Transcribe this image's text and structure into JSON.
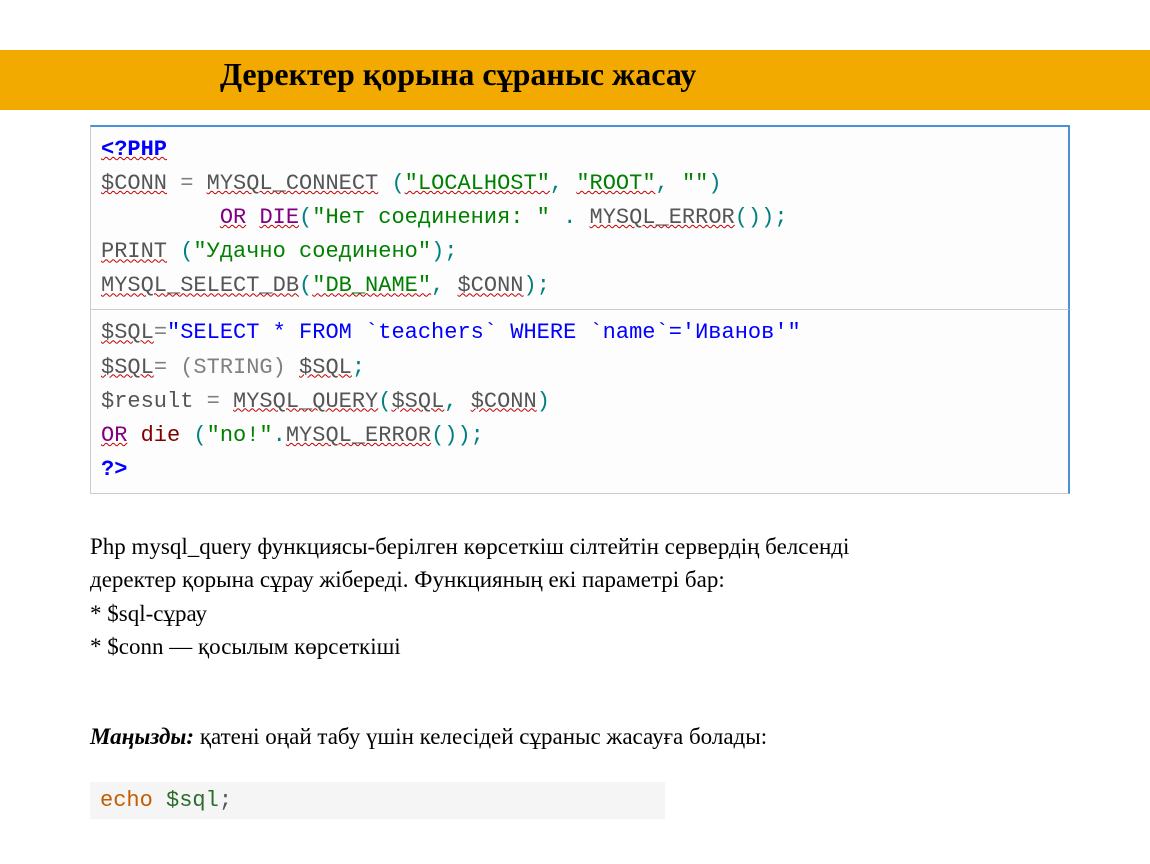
{
  "header": {
    "title": "Деректер қорына сұраныс жасау"
  },
  "code": {
    "block1": {
      "l1_open": "<?PHP",
      "l2_a": "$CONN",
      "l2_b": " = ",
      "l2_c": "MYSQL_CONNECT",
      "l2_d": " (",
      "l2_e": "\"LOCALHOST\"",
      "l2_f": ", ",
      "l2_g": "\"ROOT\"",
      "l2_h": ", ",
      "l2_i": "\"\"",
      "l2_j": ")",
      "l3_a": "         ",
      "l3_b": "OR",
      "l3_c": " ",
      "l3_d": "DIE",
      "l3_e": "(",
      "l3_f": "\"Нет соединения: \"",
      "l3_g": " . ",
      "l3_h": "MYSQL_ERROR",
      "l3_i": "());",
      "l4_a": "PRINT",
      "l4_b": " (",
      "l4_c": "\"Удачно соединено\"",
      "l4_d": ");",
      "l5_a": "MYSQL_SELECT_DB",
      "l5_b": "(",
      "l5_c": "\"DB_NAME\"",
      "l5_d": ", ",
      "l5_e": "$CONN",
      "l5_f": ");"
    },
    "block2": {
      "l1_a": "$SQL",
      "l1_b": "=",
      "l1_c": "\"SELECT * FROM `teachers` WHERE `name`='Иванов'\"",
      "l2_a": "$SQL",
      "l2_b": "= (STRING) ",
      "l2_c": "$SQL",
      "l2_d": ";",
      "l3_a": "$result",
      "l3_b": " = ",
      "l3_c": "MYSQL_QUERY",
      "l3_d": "(",
      "l3_e": "$SQL",
      "l3_f": ", ",
      "l3_g": "$CONN",
      "l3_h": ")",
      "l4_a": "OR",
      "l4_b": " ",
      "l4_c": "die",
      "l4_d": " (",
      "l4_e": "\"no!\"",
      "l4_f": ".",
      "l4_g": "MYSQL_ERROR",
      "l4_h": "());",
      "l5_close": "?>"
    }
  },
  "paragraphs": {
    "p1_line1": "Php mysql_query функциясы-берілген көрсеткіш сілтейтін сервердің белсенді",
    "p1_line2": "деректер қорына сұрау жібереді. Функцияның екі параметрі бар:",
    "p1_bullet1": "* $sql-сұрау",
    "p1_bullet2": "* $conn — қосылым көрсеткіші",
    "p2_label": "Маңызды:",
    "p2_rest": " қатені оңай табу үшін келесідей сұраныс  жасауға болады:"
  },
  "echo": {
    "kw": "echo",
    "sp": " ",
    "var": "$sql",
    "semi": ";"
  }
}
